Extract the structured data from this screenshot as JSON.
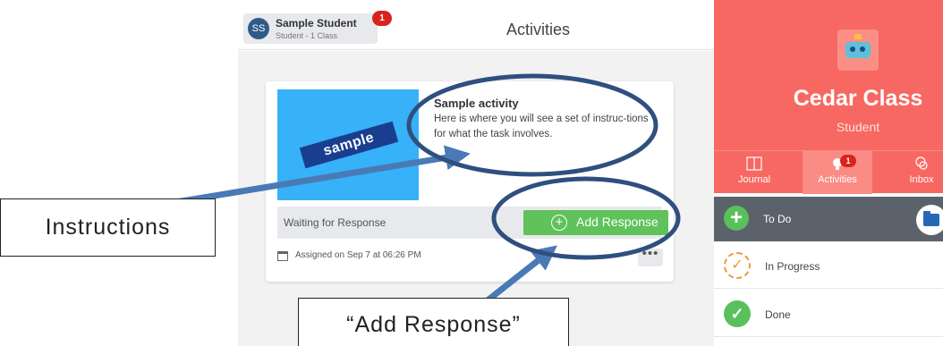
{
  "header": {
    "user_initials": "SS",
    "user_name": "Sample Student",
    "user_subtitle": "Student - 1 Class",
    "notification_count": "1",
    "title": "Activities"
  },
  "activity": {
    "thumbnail_text": "sample",
    "title": "Sample activity",
    "description": "Here is where you will see a set of instruc-tions for what the task involves.",
    "status": "Waiting for Response",
    "add_button_icon": "⊕",
    "add_button_label": "Add Response",
    "assigned": "Assigned on Sep 7 at 06:26 PM",
    "more_label": "•••"
  },
  "annotations": {
    "instructions_label": "Instructions",
    "add_response_label": "“Add Response”",
    "highlight_color": "#2f4f7f",
    "arrow_color": "#4a7ab5"
  },
  "right_panel": {
    "class_name": "Cedar Class",
    "role": "Student",
    "nav": {
      "journal": "Journal",
      "activities": "Activities",
      "activities_badge": "1",
      "inbox": "Inbox"
    },
    "todo_label": "To Do",
    "todo_icon": "+",
    "in_progress_label": "In Progress",
    "in_progress_icon": "✓",
    "done_label": "Done",
    "done_icon": "✓",
    "accent_color": "#f86862"
  }
}
